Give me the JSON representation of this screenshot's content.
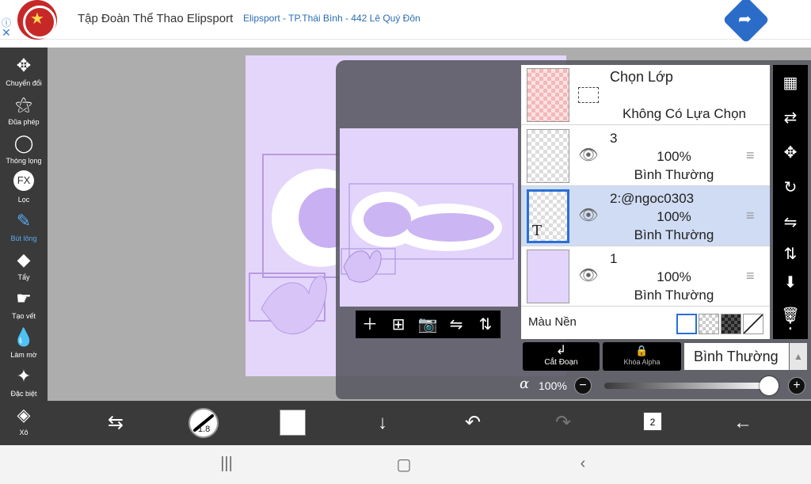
{
  "ad": {
    "info": "ⓘ",
    "close": "✕",
    "title": "Tập Đoàn Thể Thao Elipsport",
    "subtitle": "Elipsport - TP.Thái Bình - 442 Lê Quý Đôn",
    "go_icon": "➦"
  },
  "tools": [
    {
      "icon": "✥",
      "label": "Chuyển đổi",
      "name": "move-icon"
    },
    {
      "icon": "⚝",
      "label": "Đũa phép",
      "name": "magic-wand-icon"
    },
    {
      "icon": "◯",
      "label": "Thòng lọng",
      "name": "lasso-icon"
    },
    {
      "icon": "FX",
      "label": "Lọc",
      "name": "fx-icon"
    },
    {
      "icon": "✎",
      "label": "Bút lông",
      "name": "brush-icon",
      "active": true
    },
    {
      "icon": "◆",
      "label": "Tẩy",
      "name": "eraser-icon"
    },
    {
      "icon": "☛",
      "label": "Tạo vết",
      "name": "smudge-icon"
    },
    {
      "icon": "💧",
      "label": "Làm mờ",
      "name": "blur-icon"
    },
    {
      "icon": "✦",
      "label": "Đặc biệt",
      "name": "special-icon"
    },
    {
      "icon": "◈",
      "label": "Xô",
      "name": "bucket-icon"
    }
  ],
  "preview_tools": [
    "＋",
    "⊞",
    "📷",
    "⇋",
    "⇅"
  ],
  "layers_panel": {
    "selection": {
      "title": "Chọn Lớp",
      "none": "Không Có Lựa Chọn"
    },
    "layers": [
      {
        "name": "3",
        "opacity": "100%",
        "mode": "Bình Thường",
        "selected": false
      },
      {
        "name": "2:@ngoc0303",
        "opacity": "100%",
        "mode": "Bình Thường",
        "selected": true,
        "type_icon": "T"
      },
      {
        "name": "1",
        "opacity": "100%",
        "mode": "Bình Thường",
        "selected": false
      }
    ],
    "background": {
      "label": "Màu Nền"
    }
  },
  "right_tools": [
    "▦",
    "⇄",
    "✥",
    "↻",
    "⇋",
    "⇅",
    "⬇",
    "🗑",
    "⋮"
  ],
  "panel_bottom": {
    "clip": {
      "icon": "↲",
      "label": "Cắt Đoạn"
    },
    "alpha_lock": {
      "icon": "🔒",
      "label": "Khóa Alpha"
    },
    "blend_mode": "Bình Thường",
    "blend_arrow": "▲",
    "alpha_symbol": "α",
    "alpha_value": "100%",
    "alpha_fraction": 1.0,
    "minus": "−",
    "plus": "+"
  },
  "bottom_toolbar": {
    "swap_icon": "⇆",
    "brush_size": "1.8",
    "down_icon": "↓",
    "undo_icon": "↶",
    "redo_icon": "↷",
    "layer_count": "2",
    "back_icon": "←"
  },
  "navbar": {
    "recents": "|||",
    "home": "▢",
    "back": "‹"
  }
}
